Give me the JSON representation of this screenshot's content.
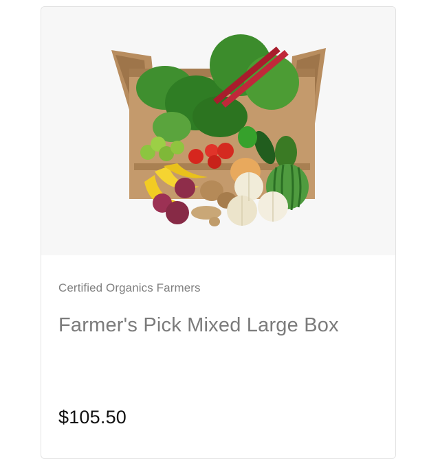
{
  "product": {
    "image_alt": "Box of mixed vegetables and fruits",
    "vendor": "Certified Organics Farmers",
    "title": "Farmer's Pick Mixed Large Box",
    "price": "$105.50"
  }
}
